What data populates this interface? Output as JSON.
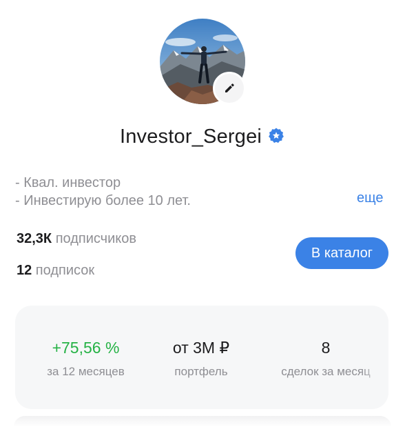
{
  "profile": {
    "username": "Investor_Sergei",
    "bio": [
      "- Квал. инвестор",
      "- Инвестирую более 10 лет."
    ],
    "more_label": "еще"
  },
  "stats": {
    "subscribers_count": "32,3К",
    "subscribers_label": " подписчиков",
    "subscriptions_count": "12",
    "subscriptions_label": " подписок"
  },
  "catalog_button_label": "В каталог",
  "metrics": [
    {
      "value": "+75,56 %",
      "caption": "за 12 месяцев"
    },
    {
      "value": "от 3М ₽",
      "caption": "портфель"
    },
    {
      "value": "8",
      "caption": "сделок за месяц"
    }
  ],
  "colors": {
    "accent": "#3b82e6",
    "positive": "#25b245",
    "muted_text": "#8e8e93",
    "card_background": "#f6f7f8"
  },
  "icons": [
    "edit-icon",
    "verified-badge-icon"
  ]
}
